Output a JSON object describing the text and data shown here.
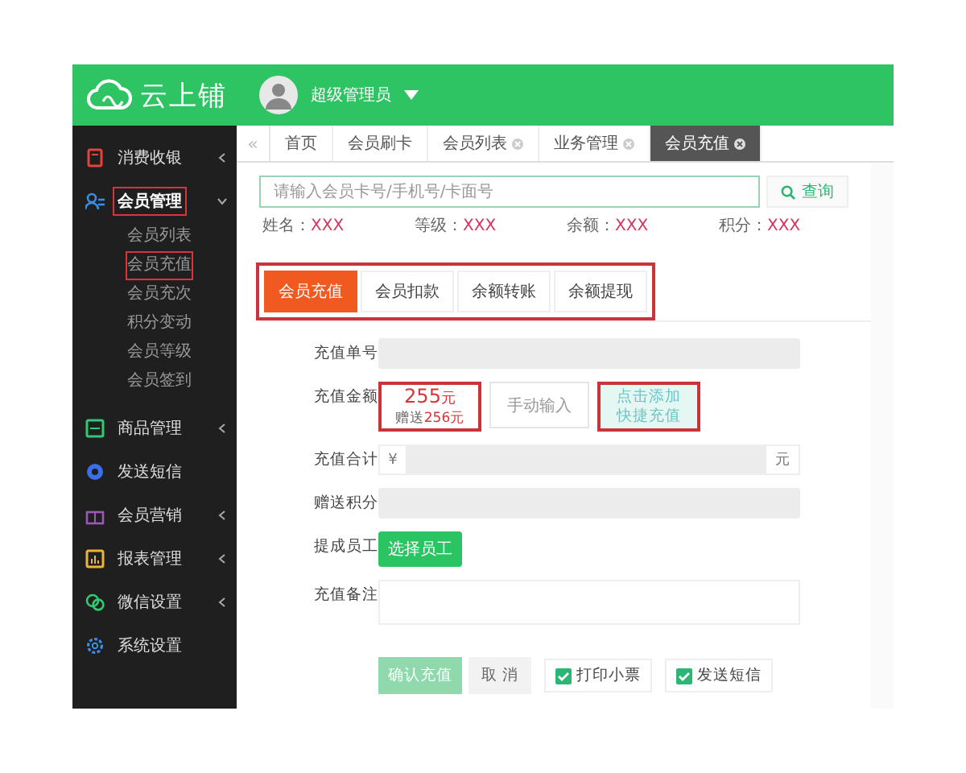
{
  "header": {
    "logo": "云上铺",
    "user": "超级管理员"
  },
  "sidebar": {
    "items": [
      {
        "label": "消费收银",
        "expanded": false,
        "selected": false,
        "annotated": false
      },
      {
        "label": "会员管理",
        "expanded": true,
        "selected": true,
        "annotated": true,
        "children": [
          {
            "label": "会员列表",
            "annotated": false
          },
          {
            "label": "会员充值",
            "annotated": true
          },
          {
            "label": "会员充次",
            "annotated": false
          },
          {
            "label": "积分变动",
            "annotated": false
          },
          {
            "label": "会员等级",
            "annotated": false
          },
          {
            "label": "会员签到",
            "annotated": false
          }
        ]
      },
      {
        "label": "商品管理",
        "expanded": false,
        "selected": false,
        "annotated": false
      },
      {
        "label": "发送短信",
        "selected": false,
        "annotated": false
      },
      {
        "label": "会员营销",
        "expanded": false,
        "selected": false,
        "annotated": false
      },
      {
        "label": "报表管理",
        "expanded": false,
        "selected": false,
        "annotated": false
      },
      {
        "label": "微信设置",
        "expanded": false,
        "selected": false,
        "annotated": false
      },
      {
        "label": "系统设置",
        "selected": false,
        "annotated": false
      }
    ]
  },
  "tab_scroll": "«",
  "tabs": [
    {
      "label": "首页",
      "closable": false,
      "selected": false
    },
    {
      "label": "会员刷卡",
      "closable": false,
      "selected": false
    },
    {
      "label": "会员列表",
      "closable": true,
      "selected": false
    },
    {
      "label": "业务管理",
      "closable": true,
      "selected": false
    },
    {
      "label": "会员充值",
      "closable": true,
      "selected": true
    }
  ],
  "search": {
    "placeholder": "请输入会员卡号/手机号/卡面号",
    "button": "查询"
  },
  "member_info": [
    {
      "label": "姓名：",
      "value": "XXX"
    },
    {
      "label": "等级：",
      "value": "XXX"
    },
    {
      "label": "余额：",
      "value": "XXX"
    },
    {
      "label": "积分：",
      "value": "XXX"
    }
  ],
  "recharge_tabs": {
    "annotated": true,
    "items": [
      {
        "label": "会员充值",
        "selected": true
      },
      {
        "label": "会员扣款",
        "selected": false
      },
      {
        "label": "余额转账",
        "selected": false
      },
      {
        "label": "余额提现",
        "selected": false
      }
    ]
  },
  "form": [
    {
      "kind": "readonly",
      "label": "充值单号"
    },
    {
      "kind": "amounts",
      "label": "充值金额",
      "preset": {
        "amount": "255",
        "unit": "元",
        "gift_label": "赠送",
        "gift": "256元",
        "annotated": true
      },
      "manual": "手动输入",
      "quick_add": {
        "lines": [
          "点击添加",
          "快捷充值"
        ],
        "annotated": true
      }
    },
    {
      "kind": "currency",
      "label": "充值合计",
      "prefix": "¥",
      "suffix": "元"
    },
    {
      "kind": "readonly",
      "label": "赠送积分"
    },
    {
      "kind": "button",
      "label": "提成员工",
      "button": "选择员工"
    },
    {
      "kind": "textarea",
      "label": "充值备注"
    }
  ],
  "actions": {
    "confirm": "确认充值",
    "cancel": "取 消",
    "options": [
      {
        "label": "打印小票",
        "checked": true
      },
      {
        "label": "发送短信",
        "checked": true
      }
    ]
  }
}
